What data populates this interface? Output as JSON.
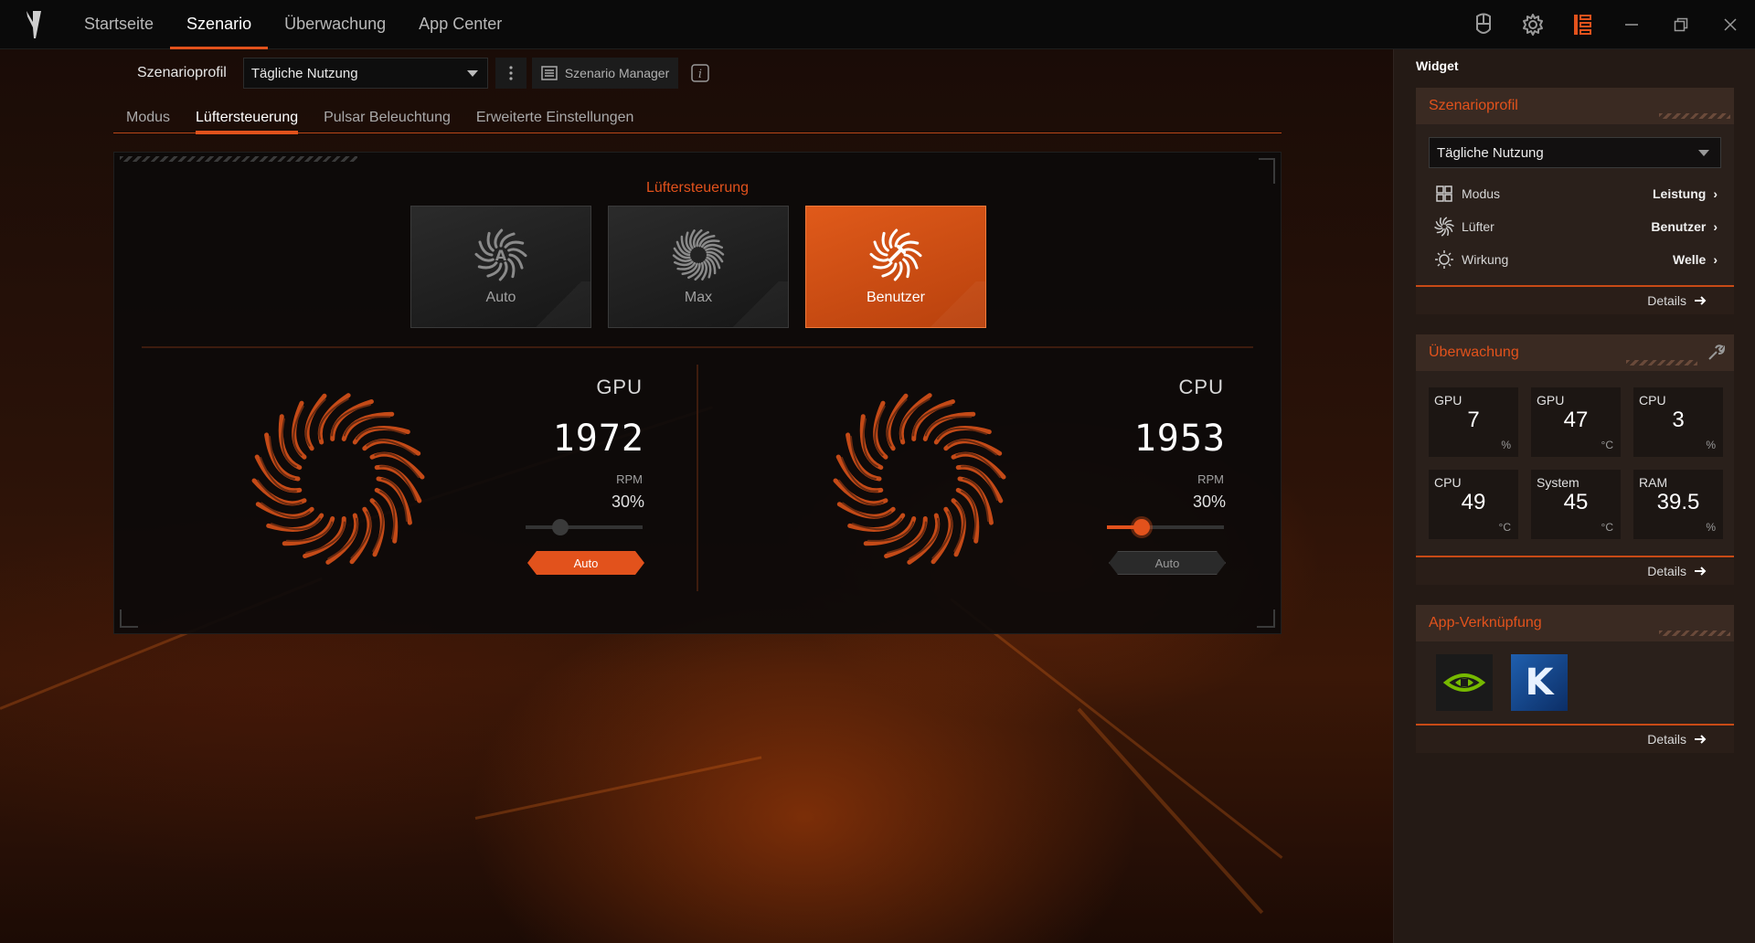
{
  "nav": {
    "tabs": [
      {
        "label": "Startseite"
      },
      {
        "label": "Szenario"
      },
      {
        "label": "Überwachung"
      },
      {
        "label": "App Center"
      }
    ]
  },
  "header": {
    "profile_label": "Szenarioprofil",
    "profile_value": "Tägliche Nutzung",
    "manager_label": "Szenario Manager"
  },
  "subtabs": [
    {
      "label": "Modus"
    },
    {
      "label": "Lüftersteuerung"
    },
    {
      "label": "Pulsar Beleuchtung"
    },
    {
      "label": "Erweiterte Einstellungen"
    }
  ],
  "fan_control": {
    "title": "Lüftersteuerung",
    "modes": [
      {
        "label": "Auto"
      },
      {
        "label": "Max"
      },
      {
        "label": "Benutzer"
      }
    ],
    "gpu": {
      "name": "GPU",
      "rpm": "1972",
      "rpm_unit": "RPM",
      "percent_label": "30%",
      "percent": 30,
      "auto_label": "Auto",
      "auto_on": true
    },
    "cpu": {
      "name": "CPU",
      "rpm": "1953",
      "rpm_unit": "RPM",
      "percent_label": "30%",
      "percent": 30,
      "auto_label": "Auto",
      "auto_on": false
    }
  },
  "widget": {
    "title": "Widget",
    "profile": {
      "title": "Szenarioprofil",
      "select": "Tägliche Nutzung",
      "rows": [
        {
          "label": "Modus",
          "value": "Leistung"
        },
        {
          "label": "Lüfter",
          "value": "Benutzer"
        },
        {
          "label": "Wirkung",
          "value": "Welle"
        }
      ],
      "details": "Details"
    },
    "monitor": {
      "title": "Überwachung",
      "tiles": [
        {
          "name": "GPU",
          "value": "7",
          "unit": "%"
        },
        {
          "name": "GPU",
          "value": "47",
          "unit": "°C"
        },
        {
          "name": "CPU",
          "value": "3",
          "unit": "%"
        },
        {
          "name": "CPU",
          "value": "49",
          "unit": "°C"
        },
        {
          "name": "System",
          "value": "45",
          "unit": "°C"
        },
        {
          "name": "RAM",
          "value": "39.5",
          "unit": "%"
        }
      ],
      "details": "Details"
    },
    "apps": {
      "title": "App-Verknüpfung",
      "items": [
        {
          "name": "nvidia-icon",
          "letter": ""
        },
        {
          "name": "killer-icon",
          "letter": "K"
        }
      ],
      "details": "Details"
    }
  },
  "colors": {
    "accent": "#e2521c",
    "accent_dark": "#b8410d",
    "panel_bg": "#0c0a0a",
    "widget_bg": "#241a15"
  }
}
